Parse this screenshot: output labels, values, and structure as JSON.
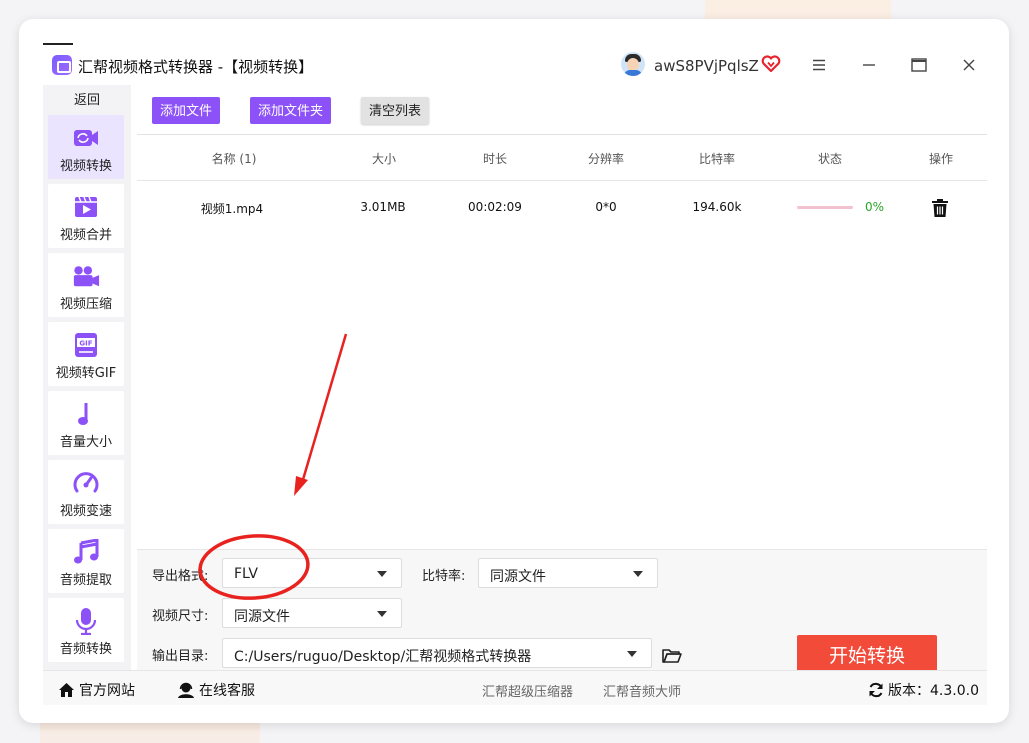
{
  "app": {
    "title": "汇帮视频格式转换器  -【视频转换】",
    "username": "awS8PVjPqlsZ",
    "icons": [
      "app-logo",
      "user-avatar",
      "vip-heart-icon",
      "menu-icon",
      "minimize-icon",
      "maximize-icon",
      "close-icon"
    ]
  },
  "sidebar": {
    "back_label": "返回",
    "items": [
      {
        "label": "视频转换",
        "icon": "video-convert-icon",
        "active": true
      },
      {
        "label": "视频合并",
        "icon": "video-merge-icon"
      },
      {
        "label": "视频压缩",
        "icon": "video-camera-icon"
      },
      {
        "label": "视频转GIF",
        "icon": "gif-icon"
      },
      {
        "label": "音量大小",
        "icon": "music-note-icon"
      },
      {
        "label": "视频变速",
        "icon": "speedometer-icon"
      },
      {
        "label": "音频提取",
        "icon": "music-notes-icon"
      },
      {
        "label": "音频转换",
        "icon": "microphone-icon"
      }
    ]
  },
  "toolbar": {
    "add_file": "添加文件",
    "add_folder": "添加文件夹",
    "clear_list": "清空列表"
  },
  "table": {
    "headers": [
      "名称 (1)",
      "大小",
      "时长",
      "分辨率",
      "比特率",
      "状态",
      "操作"
    ],
    "rows": [
      {
        "name": "视频1.mp4",
        "size": "3.01MB",
        "duration": "00:02:09",
        "resolution": "0*0",
        "bitrate": "194.60k",
        "progress": 0,
        "status_text": "0%"
      }
    ]
  },
  "settings": {
    "format_label": "导出格式:",
    "format_value": "FLV",
    "bitrate_label": "比特率:",
    "bitrate_value": "同源文件",
    "size_label": "视频尺寸:",
    "size_value": "同源文件",
    "output_label": "输出目录:",
    "output_value": "C:/Users/ruguo/Desktop/汇帮视频格式转换器",
    "start_button": "开始转换"
  },
  "footer": {
    "website": "官方网站",
    "support": "在线客服",
    "link1": "汇帮超级压缩器",
    "link2": "汇帮音频大师",
    "version": "版本：4.3.0.0"
  },
  "colors": {
    "accent": "#8c51f7",
    "start_button": "#f24b3a",
    "progress_text": "#2aa52a",
    "annotation": "#e8231f"
  }
}
